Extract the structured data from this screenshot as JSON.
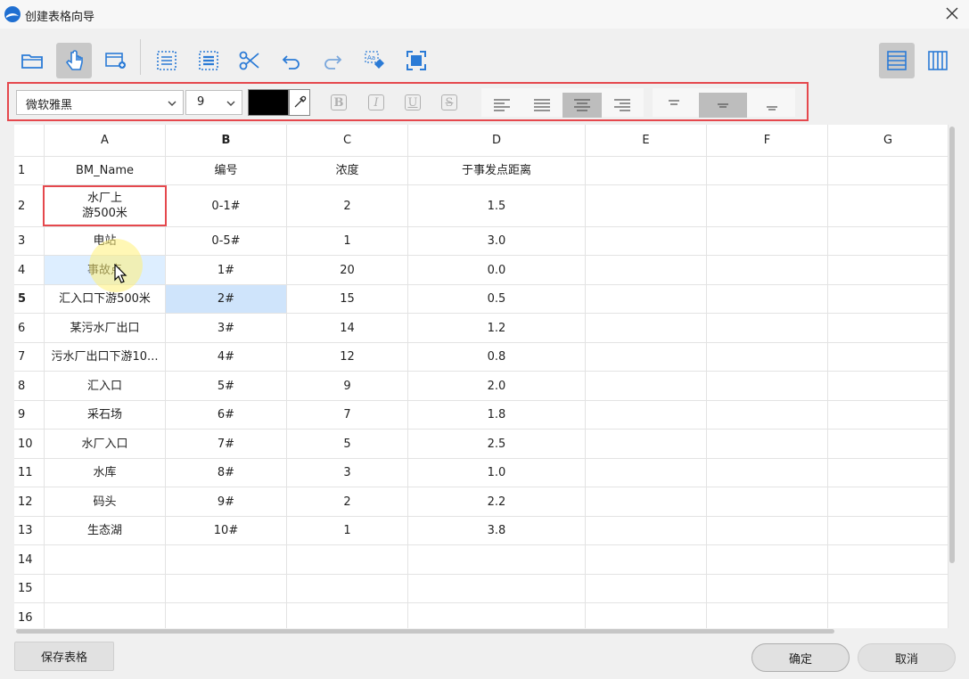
{
  "window": {
    "title": "创建表格向导"
  },
  "toolbar": {
    "tools": [
      {
        "name": "open-folder-icon",
        "active": false
      },
      {
        "name": "hand-pointer-icon",
        "active": true
      },
      {
        "name": "insert-table-icon",
        "active": false
      },
      {
        "name": "text-align-icon",
        "active": false
      },
      {
        "name": "list-box-icon",
        "active": false
      },
      {
        "name": "scissors-icon",
        "active": false
      },
      {
        "name": "undo-icon",
        "active": false
      },
      {
        "name": "redo-icon",
        "active": false
      },
      {
        "name": "clear-format-icon",
        "active": false
      },
      {
        "name": "fullscreen-icon",
        "active": false
      }
    ],
    "layout_row_icon": "rows-layout-icon",
    "layout_col_icon": "columns-layout-icon"
  },
  "format": {
    "font": "微软雅黑",
    "size": "9",
    "color": "#000000",
    "bold": "B",
    "italic": "I",
    "underline": "U",
    "strike": "S"
  },
  "grid": {
    "columns": [
      "A",
      "B",
      "C",
      "D",
      "E",
      "F",
      "G"
    ],
    "rows": [
      {
        "n": "1",
        "cells": [
          "BM_Name",
          "编号",
          "浓度",
          "于事发点距离",
          "",
          "",
          ""
        ]
      },
      {
        "n": "2",
        "cells": [
          "水厂上\n游500米",
          "0-1#",
          "2",
          "1.5",
          "",
          "",
          ""
        ]
      },
      {
        "n": "3",
        "cells": [
          "电站",
          "0-5#",
          "1",
          "3.0",
          "",
          "",
          ""
        ]
      },
      {
        "n": "4",
        "cells": [
          "事故点",
          "1#",
          "20",
          "0.0",
          "",
          "",
          ""
        ]
      },
      {
        "n": "5",
        "cells": [
          "汇入口下游500米",
          "2#",
          "15",
          "0.5",
          "",
          "",
          ""
        ]
      },
      {
        "n": "6",
        "cells": [
          "某污水厂出口",
          "3#",
          "14",
          "1.2",
          "",
          "",
          ""
        ]
      },
      {
        "n": "7",
        "cells": [
          "污水厂出口下游10...",
          "4#",
          "12",
          "0.8",
          "",
          "",
          ""
        ]
      },
      {
        "n": "8",
        "cells": [
          "汇入口",
          "5#",
          "9",
          "2.0",
          "",
          "",
          ""
        ]
      },
      {
        "n": "9",
        "cells": [
          "采石场",
          "6#",
          "7",
          "1.8",
          "",
          "",
          ""
        ]
      },
      {
        "n": "10",
        "cells": [
          "水厂入口",
          "7#",
          "5",
          "2.5",
          "",
          "",
          ""
        ]
      },
      {
        "n": "11",
        "cells": [
          "水库",
          "8#",
          "3",
          "1.0",
          "",
          "",
          ""
        ]
      },
      {
        "n": "12",
        "cells": [
          "码头",
          "9#",
          "2",
          "2.2",
          "",
          "",
          ""
        ]
      },
      {
        "n": "13",
        "cells": [
          "生态湖",
          "10#",
          "1",
          "3.8",
          "",
          "",
          ""
        ]
      },
      {
        "n": "14",
        "cells": [
          "",
          "",
          "",
          "",
          "",
          "",
          ""
        ]
      },
      {
        "n": "15",
        "cells": [
          "",
          "",
          "",
          "",
          "",
          "",
          ""
        ]
      },
      {
        "n": "16",
        "cells": [
          "",
          "",
          "",
          "",
          "",
          "",
          ""
        ]
      }
    ],
    "selected": {
      "row": "5",
      "col": "B"
    }
  },
  "footer": {
    "save_label": "保存表格",
    "ok_label": "确定",
    "cancel_label": "取消"
  }
}
